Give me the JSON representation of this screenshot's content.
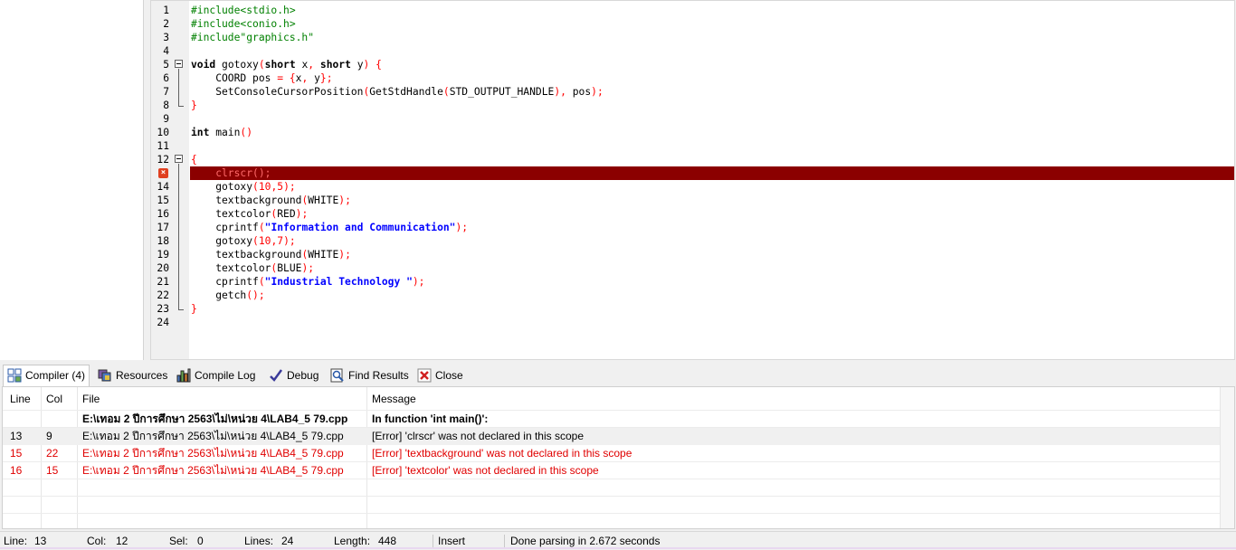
{
  "editor": {
    "lines": [
      {
        "n": "1",
        "fold": "",
        "parts": [
          {
            "t": "#include<stdio.h>",
            "c": "pp"
          }
        ]
      },
      {
        "n": "2",
        "fold": "",
        "parts": [
          {
            "t": "#include<conio.h>",
            "c": "pp"
          }
        ]
      },
      {
        "n": "3",
        "fold": "",
        "parts": [
          {
            "t": "#include\"graphics.h\"",
            "c": "pp"
          }
        ]
      },
      {
        "n": "4",
        "fold": "",
        "parts": []
      },
      {
        "n": "5",
        "fold": "open",
        "parts": [
          {
            "t": "void",
            "c": "kw"
          },
          {
            "t": " gotoxy"
          },
          {
            "t": "(",
            "c": "sym"
          },
          {
            "t": "short",
            "c": "kw"
          },
          {
            "t": " x"
          },
          {
            "t": ",",
            "c": "sym"
          },
          {
            "t": " "
          },
          {
            "t": "short",
            "c": "kw"
          },
          {
            "t": " y"
          },
          {
            "t": ")",
            "c": "sym"
          },
          {
            "t": " "
          },
          {
            "t": "{",
            "c": "sym"
          }
        ]
      },
      {
        "n": "6",
        "fold": "line",
        "parts": [
          {
            "t": "    COORD pos "
          },
          {
            "t": "=",
            "c": "sym"
          },
          {
            "t": " "
          },
          {
            "t": "{",
            "c": "sym"
          },
          {
            "t": "x"
          },
          {
            "t": ",",
            "c": "sym"
          },
          {
            "t": " y"
          },
          {
            "t": "};",
            "c": "sym"
          }
        ]
      },
      {
        "n": "7",
        "fold": "line",
        "parts": [
          {
            "t": "    SetConsoleCursorPosition"
          },
          {
            "t": "(",
            "c": "sym"
          },
          {
            "t": "GetStdHandle"
          },
          {
            "t": "(",
            "c": "sym"
          },
          {
            "t": "STD_OUTPUT_HANDLE"
          },
          {
            "t": "),",
            "c": "sym"
          },
          {
            "t": " pos"
          },
          {
            "t": ");",
            "c": "sym"
          }
        ]
      },
      {
        "n": "8",
        "fold": "end",
        "parts": [
          {
            "t": "}",
            "c": "sym"
          }
        ]
      },
      {
        "n": "9",
        "fold": "",
        "parts": []
      },
      {
        "n": "10",
        "fold": "",
        "parts": [
          {
            "t": "int",
            "c": "kw"
          },
          {
            "t": " main"
          },
          {
            "t": "()",
            "c": "sym"
          }
        ]
      },
      {
        "n": "11",
        "fold": "",
        "parts": []
      },
      {
        "n": "12",
        "fold": "open",
        "parts": [
          {
            "t": "{",
            "c": "sym"
          }
        ]
      },
      {
        "n": "13",
        "fold": "line",
        "error": true,
        "parts": [
          {
            "t": "    clrscr"
          },
          {
            "t": "();"
          }
        ]
      },
      {
        "n": "14",
        "fold": "line",
        "parts": [
          {
            "t": "    gotoxy"
          },
          {
            "t": "(",
            "c": "sym"
          },
          {
            "t": "10",
            "c": "num"
          },
          {
            "t": ",",
            "c": "sym"
          },
          {
            "t": "5",
            "c": "num"
          },
          {
            "t": ");",
            "c": "sym"
          }
        ]
      },
      {
        "n": "15",
        "fold": "line",
        "parts": [
          {
            "t": "    textbackground"
          },
          {
            "t": "(",
            "c": "sym"
          },
          {
            "t": "WHITE"
          },
          {
            "t": ");",
            "c": "sym"
          }
        ]
      },
      {
        "n": "16",
        "fold": "line",
        "parts": [
          {
            "t": "    textcolor"
          },
          {
            "t": "(",
            "c": "sym"
          },
          {
            "t": "RED"
          },
          {
            "t": ");",
            "c": "sym"
          }
        ]
      },
      {
        "n": "17",
        "fold": "line",
        "parts": [
          {
            "t": "    cprintf"
          },
          {
            "t": "(",
            "c": "sym"
          },
          {
            "t": "\"Information and Communication\"",
            "c": "str"
          },
          {
            "t": ");",
            "c": "sym"
          }
        ]
      },
      {
        "n": "18",
        "fold": "line",
        "parts": [
          {
            "t": "    gotoxy"
          },
          {
            "t": "(",
            "c": "sym"
          },
          {
            "t": "10",
            "c": "num"
          },
          {
            "t": ",",
            "c": "sym"
          },
          {
            "t": "7",
            "c": "num"
          },
          {
            "t": ");",
            "c": "sym"
          }
        ]
      },
      {
        "n": "19",
        "fold": "line",
        "parts": [
          {
            "t": "    textbackground"
          },
          {
            "t": "(",
            "c": "sym"
          },
          {
            "t": "WHITE"
          },
          {
            "t": ");",
            "c": "sym"
          }
        ]
      },
      {
        "n": "20",
        "fold": "line",
        "parts": [
          {
            "t": "    textcolor"
          },
          {
            "t": "(",
            "c": "sym"
          },
          {
            "t": "BLUE"
          },
          {
            "t": ");",
            "c": "sym"
          }
        ]
      },
      {
        "n": "21",
        "fold": "line",
        "parts": [
          {
            "t": "    cprintf"
          },
          {
            "t": "(",
            "c": "sym"
          },
          {
            "t": "\"Industrial Technology \"",
            "c": "str"
          },
          {
            "t": ");",
            "c": "sym"
          }
        ]
      },
      {
        "n": "22",
        "fold": "line",
        "parts": [
          {
            "t": "    getch"
          },
          {
            "t": "();",
            "c": "sym"
          }
        ]
      },
      {
        "n": "23",
        "fold": "end",
        "parts": [
          {
            "t": "}",
            "c": "sym"
          }
        ]
      },
      {
        "n": "24",
        "fold": "",
        "parts": []
      }
    ]
  },
  "tabs": [
    {
      "label": "Compiler (4)",
      "icon": "compiler-grid-icon",
      "active": true
    },
    {
      "label": "Resources",
      "icon": "resources-icon",
      "active": false
    },
    {
      "label": "Compile Log",
      "icon": "compile-log-chart-icon",
      "active": false
    },
    {
      "label": "Debug",
      "icon": "debug-check-icon",
      "active": false
    },
    {
      "label": "Find Results",
      "icon": "find-results-icon",
      "active": false
    },
    {
      "label": "Close",
      "icon": "close-icon",
      "active": false
    }
  ],
  "results": {
    "headers": {
      "line": "Line",
      "col": "Col",
      "file": "File",
      "message": "Message"
    },
    "rows": [
      {
        "line": "",
        "col": "",
        "file": "E:\\เทอม 2 ปีการศึกษา 2563\\ไม่\\หน่วย 4\\LAB4_5 79.cpp",
        "message": "In function 'int main()':",
        "style": "hdrrow"
      },
      {
        "line": "13",
        "col": "9",
        "file": "E:\\เทอม 2 ปีการศึกษา 2563\\ไม่\\หน่วย 4\\LAB4_5 79.cpp",
        "message": "[Error] 'clrscr' was not declared in this scope",
        "style": "sel"
      },
      {
        "line": "15",
        "col": "22",
        "file": "E:\\เทอม 2 ปีการศึกษา 2563\\ไม่\\หน่วย 4\\LAB4_5 79.cpp",
        "message": "[Error] 'textbackground' was not declared in this scope",
        "style": "err"
      },
      {
        "line": "16",
        "col": "15",
        "file": "E:\\เทอม 2 ปีการศึกษา 2563\\ไม่\\หน่วย 4\\LAB4_5 79.cpp",
        "message": "[Error] 'textcolor' was not declared in this scope",
        "style": "err"
      }
    ]
  },
  "status": {
    "line_label": "Line:",
    "line_value": "13",
    "col_label": "Col:",
    "col_value": "12",
    "sel_label": "Sel:",
    "sel_value": "0",
    "lines_label": "Lines:",
    "lines_value": "24",
    "length_label": "Length:",
    "length_value": "448",
    "mode": "Insert",
    "message": "Done parsing in 2.672 seconds"
  },
  "colors": {
    "error_line_bg": "#8b0000",
    "error_text": "#e00000",
    "preprocessor": "#008000",
    "string": "#0000ff",
    "symbol": "#ff0000"
  }
}
